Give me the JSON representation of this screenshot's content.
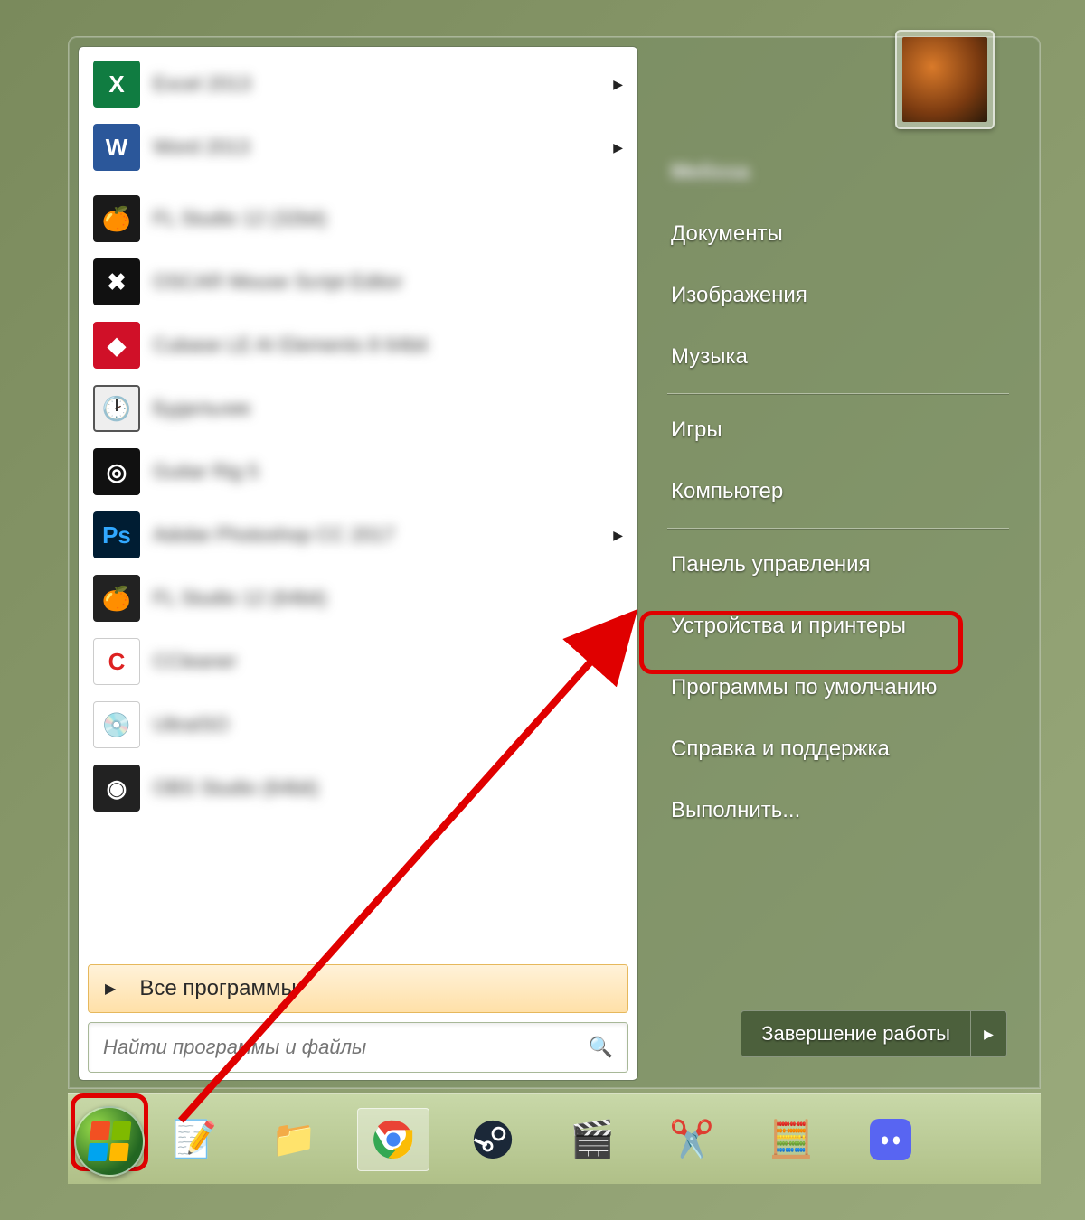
{
  "left": {
    "programs": [
      {
        "icon": "excel-icon",
        "label": "Excel 2013",
        "has_submenu": true
      },
      {
        "icon": "word-icon",
        "label": "Word 2013",
        "has_submenu": true
      },
      {
        "icon": "flstudio-icon",
        "label": "FL Studio 12 (32bit)",
        "has_submenu": false
      },
      {
        "icon": "oscar-icon",
        "label": "OSCAR Mouse Script Editor",
        "has_submenu": false
      },
      {
        "icon": "cubase-icon",
        "label": "Cubase LE AI Elements 8 64bit",
        "has_submenu": false
      },
      {
        "icon": "alarm-icon",
        "label": "Будильник",
        "has_submenu": false
      },
      {
        "icon": "guitar-rig-icon",
        "label": "Guitar Rig 5",
        "has_submenu": false
      },
      {
        "icon": "photoshop-icon",
        "label": "Adobe Photoshop CC 2017",
        "has_submenu": true
      },
      {
        "icon": "flstudio-icon",
        "label": "FL Studio 12 (64bit)",
        "has_submenu": false
      },
      {
        "icon": "ccleaner-icon",
        "label": "CCleaner",
        "has_submenu": true
      },
      {
        "icon": "ultraiso-icon",
        "label": "UltraISO",
        "has_submenu": false
      },
      {
        "icon": "obs-icon",
        "label": "OBS Studio (64bit)",
        "has_submenu": false
      }
    ],
    "all_programs_label": "Все программы",
    "search_placeholder": "Найти программы и файлы"
  },
  "right": {
    "username": "Melissa",
    "items_top": [
      "Документы",
      "Изображения",
      "Музыка"
    ],
    "items_mid": [
      "Игры",
      "Компьютер"
    ],
    "items_bot": [
      "Панель управления",
      "Устройства и принтеры",
      "Программы по умолчанию",
      "Справка и поддержка",
      "Выполнить..."
    ],
    "highlighted_index": 0,
    "shutdown_label": "Завершение работы"
  },
  "taskbar": {
    "items": [
      "notepad-icon",
      "explorer-icon",
      "chrome-icon",
      "steam-icon",
      "mpc-icon",
      "snipping-icon",
      "calculator-icon",
      "discord-icon"
    ],
    "active_index": 2
  },
  "annotation": {
    "highlights": [
      "start-button",
      "control-panel-item"
    ],
    "arrow": "from start-button to control-panel-item"
  }
}
